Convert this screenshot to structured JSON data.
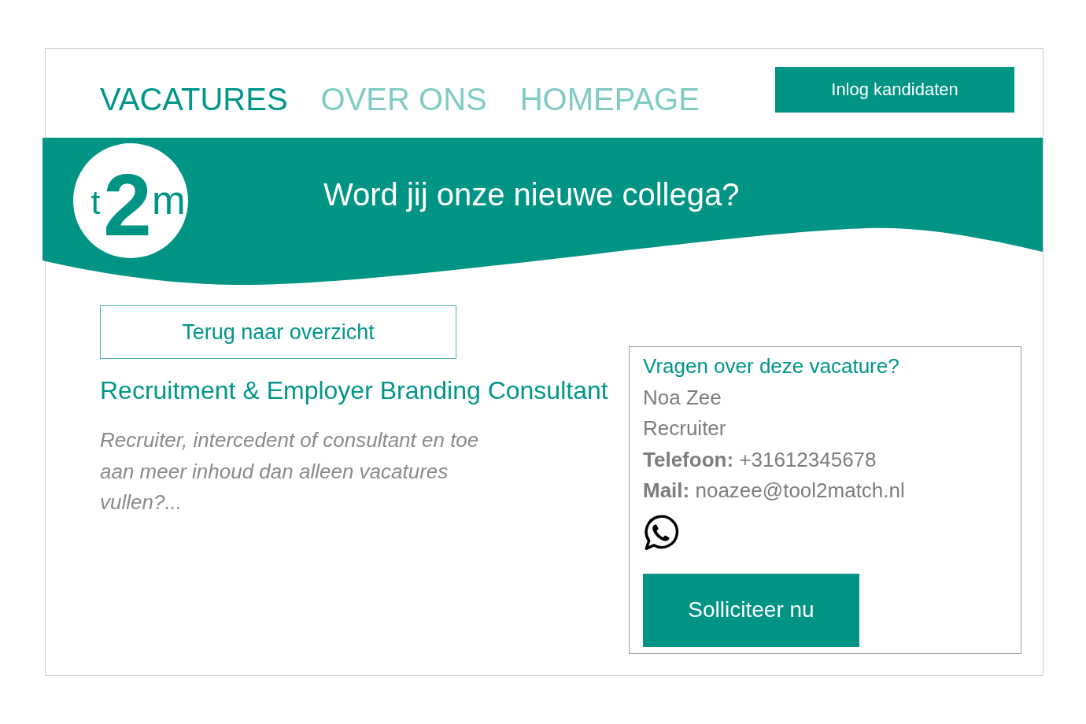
{
  "nav": {
    "items": [
      {
        "label": "VACATURES",
        "selected": true
      },
      {
        "label": "OVER ONS",
        "selected": false
      },
      {
        "label": "HOMEPAGE",
        "selected": false
      }
    ],
    "login_button": "Inlog kandidaten"
  },
  "banner": {
    "logo": {
      "letters": [
        "t",
        "2",
        "m"
      ]
    },
    "title": "Word jij onze nieuwe collega?"
  },
  "back_button": "Terug naar overzicht",
  "job": {
    "title": "Recruitment & Employer Branding Consultant",
    "summary": "Recruiter, intercedent of consultant en toe aan meer inhoud dan alleen vacatures vullen?..."
  },
  "contact": {
    "heading": "Vragen over deze vacature?",
    "name": "Noa Zee",
    "role": "Recruiter",
    "details": [
      "**Telefoon:** +31612345678",
      "**Mail:** noazee@tool2match.nl"
    ],
    "apply_button": "Solliciteer nu"
  }
}
